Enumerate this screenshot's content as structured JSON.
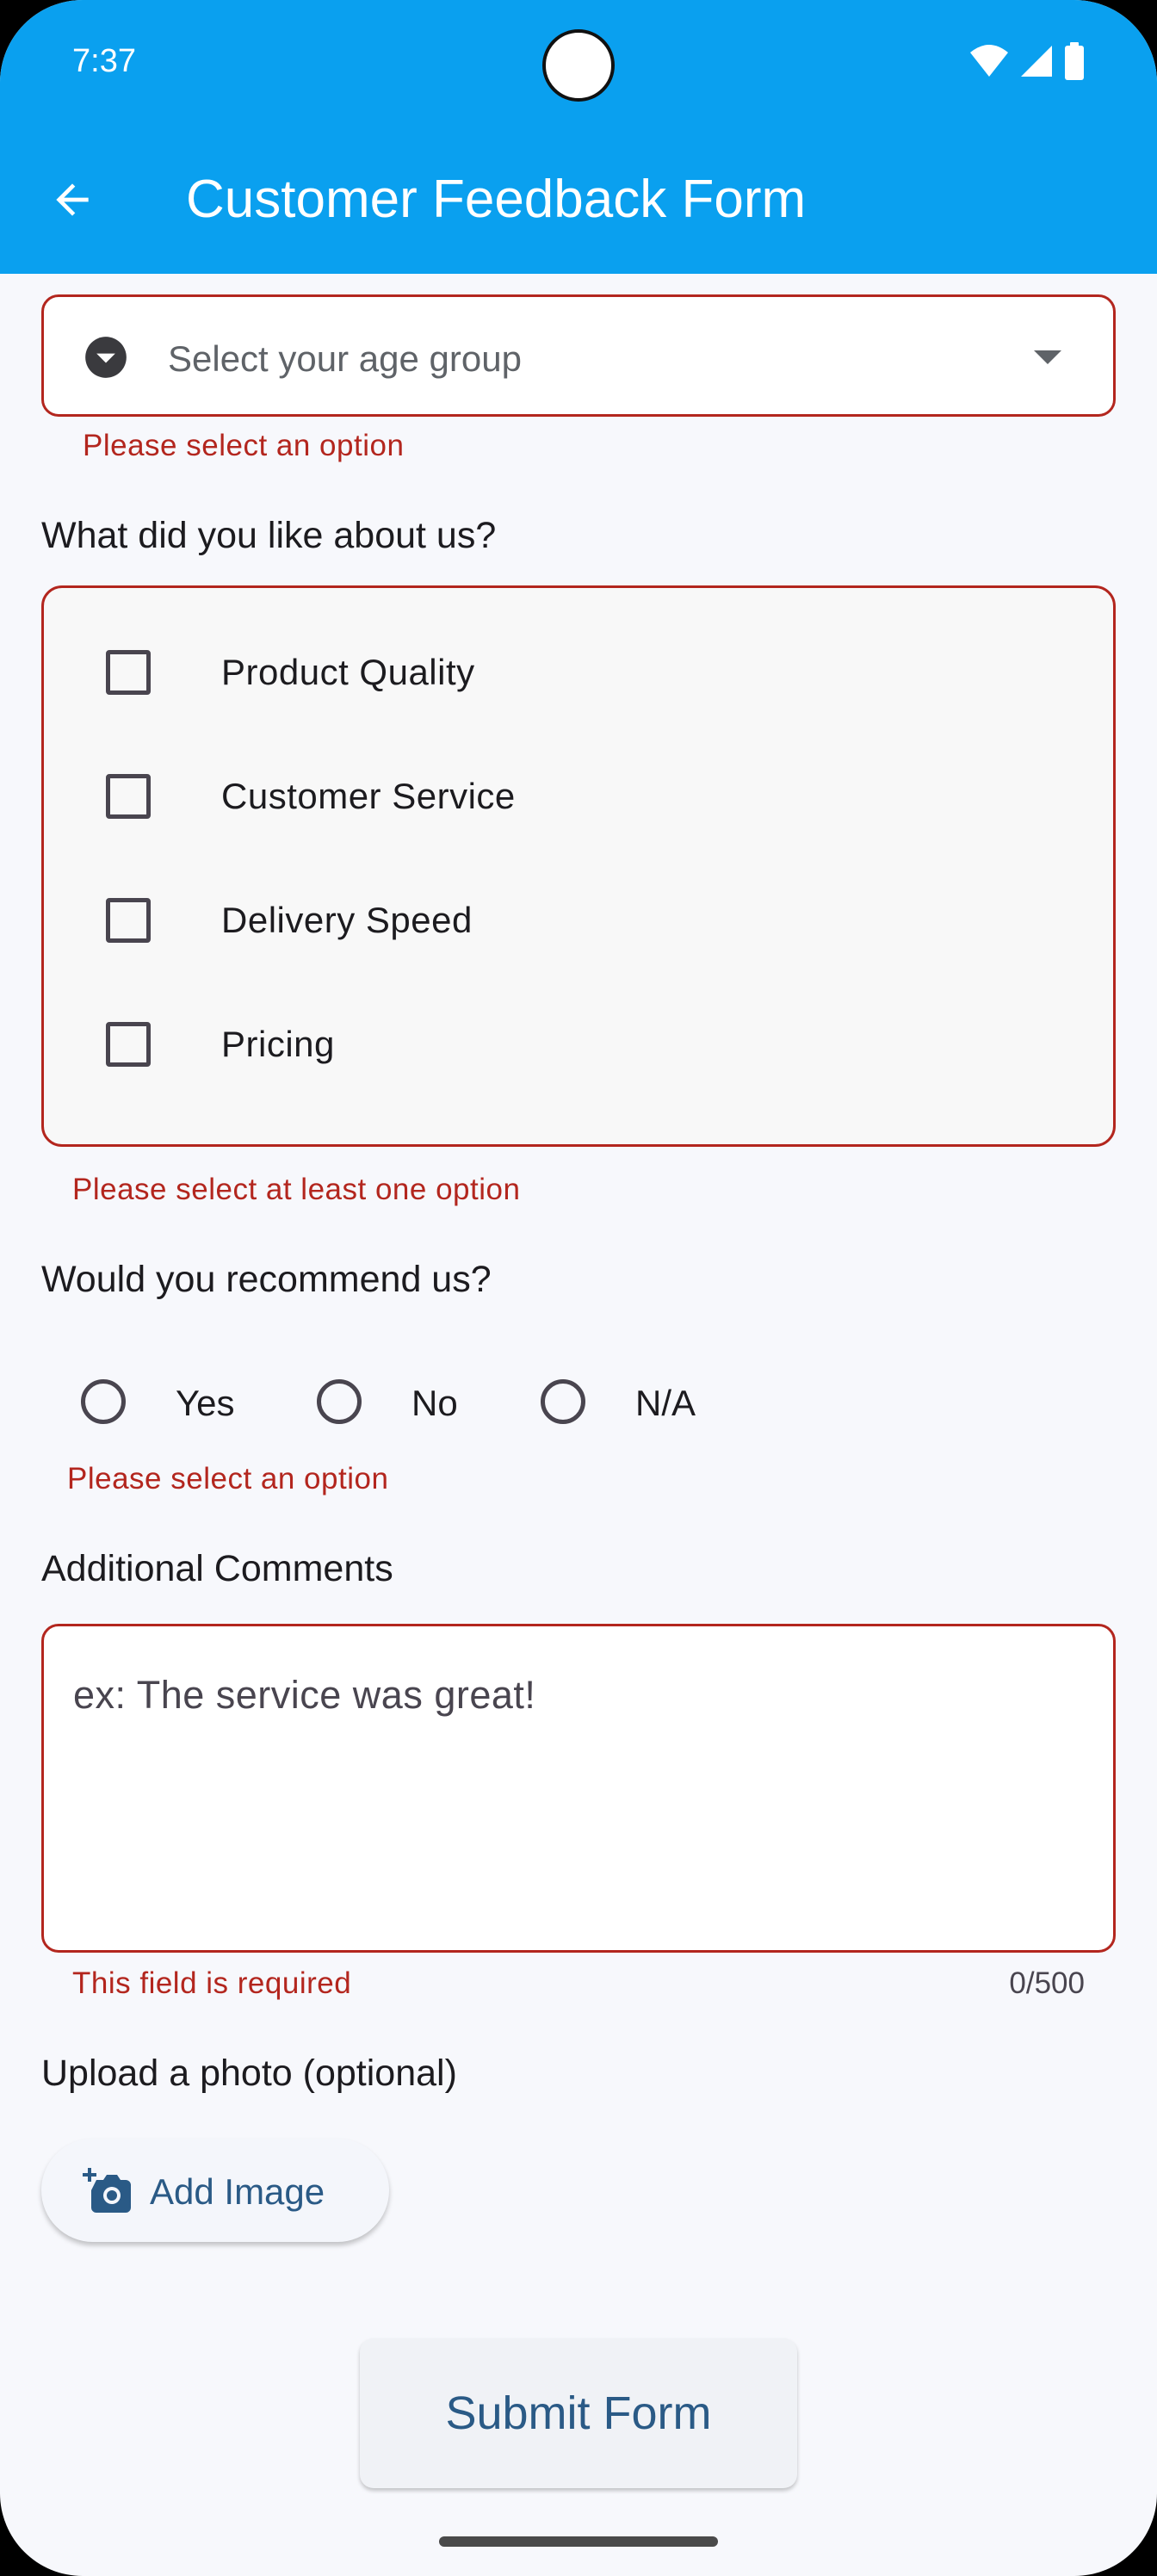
{
  "status_bar": {
    "time": "7:37",
    "icons": [
      "wifi-icon",
      "signal-icon",
      "battery-icon"
    ]
  },
  "app_bar": {
    "back_icon": "arrow-left-icon",
    "title": "Customer Feedback Form",
    "color": "#0aa0ef"
  },
  "age_group": {
    "placeholder": "Select your age group",
    "icon": "chevron-circle-down-icon",
    "error": "Please select an option"
  },
  "likes": {
    "title": "What did you like about us?",
    "options": [
      {
        "label": "Product Quality",
        "checked": false
      },
      {
        "label": "Customer Service",
        "checked": false
      },
      {
        "label": "Delivery Speed",
        "checked": false
      },
      {
        "label": "Pricing",
        "checked": false
      }
    ],
    "error": "Please select at least one option"
  },
  "recommend": {
    "title": "Would you recommend us?",
    "options": [
      "Yes",
      "No",
      "N/A"
    ],
    "error": "Please select an option"
  },
  "comments": {
    "title": "Additional Comments",
    "placeholder": "ex: The service was great!",
    "value": "",
    "error": "This field is required",
    "counter": "0/500"
  },
  "photo": {
    "title": "Upload a photo (optional)",
    "button_label": "Add Image",
    "icon": "add-photo-icon"
  },
  "submit": {
    "label": "Submit Form"
  },
  "colors": {
    "error": "#b3261e",
    "button_text": "#2a5a86"
  }
}
